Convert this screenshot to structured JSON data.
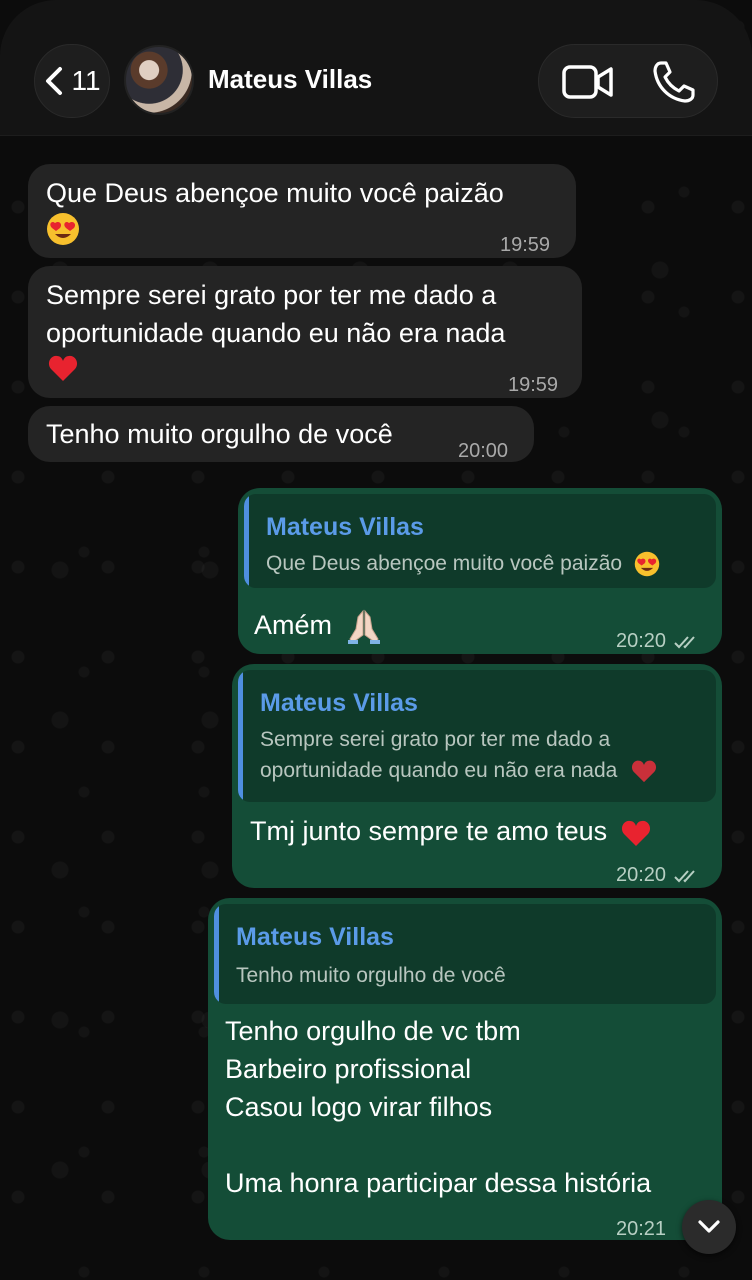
{
  "header": {
    "back_count": "11",
    "contact_name": "Mateus Villas"
  },
  "messages": {
    "m1": {
      "text": "Que Deus abençoe muito você paizão",
      "time": "19:59"
    },
    "m2": {
      "line1": "Sempre serei grato por ter me dado a",
      "line2": "oportunidade quando eu não era nada",
      "time": "19:59"
    },
    "m3": {
      "text": "Tenho muito orgulho de você",
      "time": "20:00"
    },
    "m4": {
      "reply_name": "Mateus Villas",
      "reply_text": "Que Deus abençoe muito você paizão",
      "text": "Amém",
      "time": "20:20"
    },
    "m5": {
      "reply_name": "Mateus Villas",
      "reply_line1": "Sempre serei grato por ter me dado a",
      "reply_line2": "oportunidade quando eu não era nada",
      "text": "Tmj junto sempre te amo teus",
      "time": "20:20"
    },
    "m6": {
      "reply_name": "Mateus Villas",
      "reply_text": "Tenho muito orgulho de você",
      "line1": "Tenho orgulho de vc tbm",
      "line2": "Barbeiro profissional",
      "line3": "Casou logo virar filhos",
      "line4": "Uma honra participar dessa história",
      "time": "20:21"
    }
  },
  "colors": {
    "incoming_bubble": "#242424",
    "outgoing_bubble": "#144d37",
    "reply_accent": "#4f8fe0"
  },
  "icons": [
    "chevron-left-icon",
    "video-call-icon",
    "phone-icon",
    "double-check-icon",
    "heart-eyes-emoji",
    "red-heart-emoji",
    "praying-hands-emoji",
    "chevron-down-icon"
  ]
}
